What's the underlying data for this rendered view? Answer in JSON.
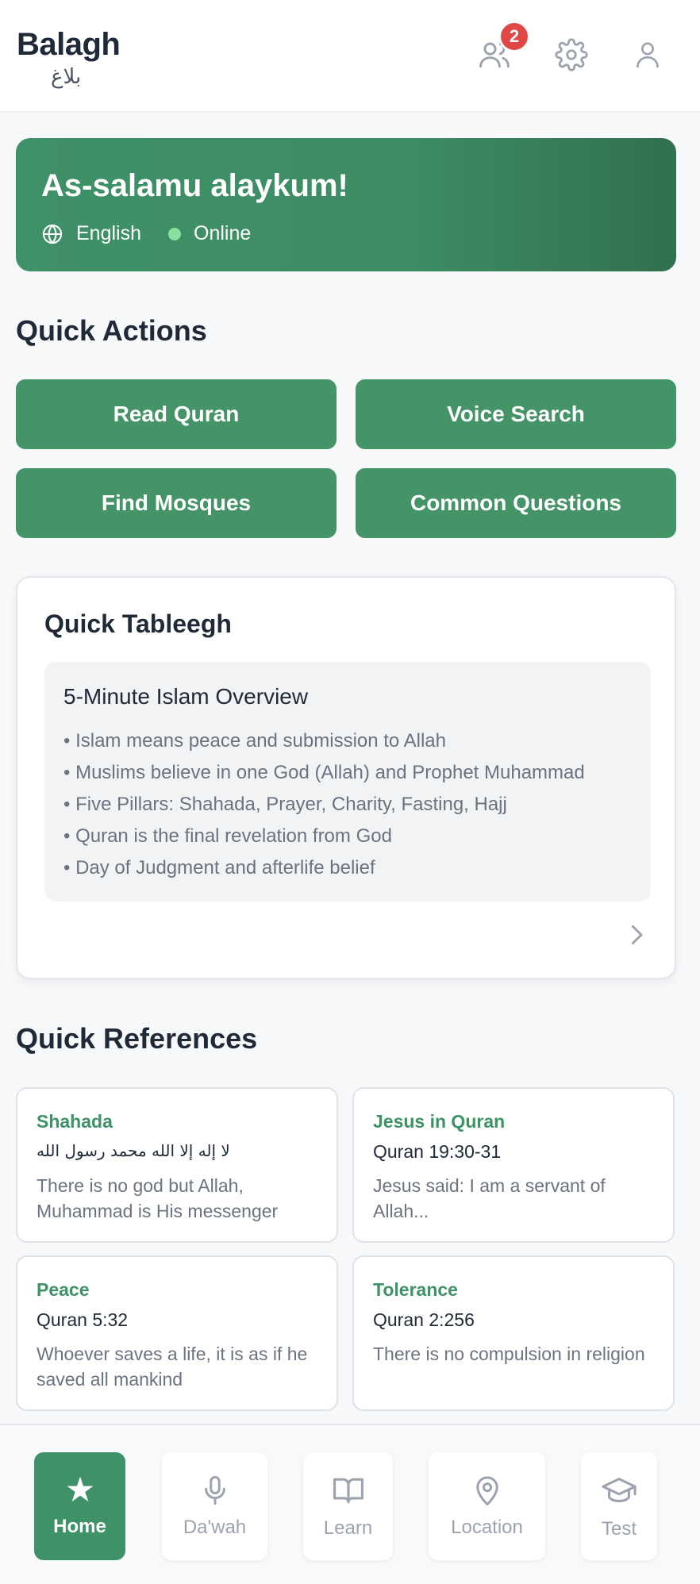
{
  "header": {
    "brand_title": "Balagh",
    "brand_subtitle": "بلاغ",
    "notification_count": "2",
    "icons": [
      "users-icon",
      "gear-icon",
      "user-icon"
    ]
  },
  "hero": {
    "greeting": "As-salamu alaykum!",
    "language": "English",
    "status": "Online"
  },
  "quick_actions": {
    "title": "Quick Actions",
    "buttons": [
      "Read Quran",
      "Voice Search",
      "Find Mosques",
      "Common Questions"
    ]
  },
  "quick_tableegh": {
    "title": "Quick Tableegh",
    "overview_title": "5-Minute Islam Overview",
    "points": [
      "• Islam means peace and submission to Allah",
      "• Muslims believe in one God (Allah) and Prophet Muhammad",
      "• Five Pillars: Shahada, Prayer, Charity, Fasting, Hajj",
      "• Quran is the final revelation from God",
      "• Day of Judgment and afterlife belief"
    ]
  },
  "quick_references": {
    "title": "Quick References",
    "cards": [
      {
        "label": "Shahada",
        "source": "لا إله إلا الله محمد رسول الله",
        "text": "There is no god but Allah, Muhammad is His messenger"
      },
      {
        "label": "Jesus in Quran",
        "source": "Quran 19:30-31",
        "text": "Jesus said: I am a servant of Allah..."
      },
      {
        "label": "Peace",
        "source": "Quran 5:32",
        "text": "Whoever saves a life, it is as if he saved all mankind"
      },
      {
        "label": "Tolerance",
        "source": "Quran 2:256",
        "text": "There is no compulsion in religion"
      }
    ]
  },
  "bottom_nav": {
    "items": [
      {
        "label": "Home",
        "icon": "star-icon",
        "active": true
      },
      {
        "label": "Da'wah",
        "icon": "microphone-icon",
        "active": false
      },
      {
        "label": "Learn",
        "icon": "book-icon",
        "active": false
      },
      {
        "label": "Location",
        "icon": "map-pin-icon",
        "active": false
      },
      {
        "label": "Test",
        "icon": "graduation-cap-icon",
        "active": false
      }
    ]
  },
  "colors": {
    "accent": "#3f9168",
    "badge": "#e04848",
    "online": "#86e29e"
  }
}
